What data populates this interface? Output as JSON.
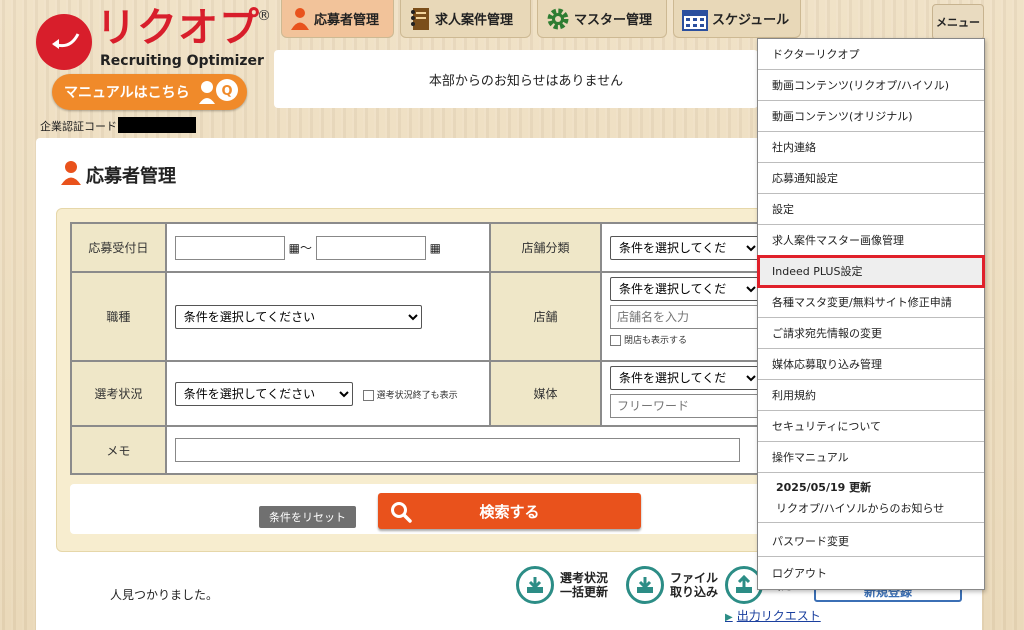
{
  "logo": {
    "kana": "リクオプ",
    "registered": "®",
    "subtitle": "Recruiting Optimizer"
  },
  "manual_button": {
    "label": "マニュアルはこちら",
    "badge": "Q"
  },
  "auth": {
    "label": "企業認証コード:"
  },
  "nav": {
    "tabs": [
      {
        "label": "応募者管理",
        "icon": "person-icon",
        "active": true
      },
      {
        "label": "求人案件管理",
        "icon": "notebook-icon",
        "active": false
      },
      {
        "label": "マスター管理",
        "icon": "gear-icon",
        "active": false
      },
      {
        "label": "スケジュール",
        "icon": "calendar-icon",
        "active": false
      }
    ],
    "menu_label": "メニュー"
  },
  "notice": {
    "text": "本部からのお知らせはありません"
  },
  "page": {
    "title": "応募者管理"
  },
  "form": {
    "date_label": "応募受付日",
    "date_separator": "～",
    "store_category_label": "店舗分類",
    "store_category_value": "条件を選択してくだ",
    "job_type_label": "職種",
    "job_type_value": "条件を選択してください",
    "store_label": "店舗",
    "store_value": "条件を選択してくだ",
    "store_name_placeholder": "店舗名を入力",
    "closed_store_label": "閉店も表示する",
    "status_label": "選考状況",
    "status_value": "条件を選択してください",
    "status_done_label": "選考状況終了も表示",
    "media_label": "媒体",
    "media_value": "条件を選択してくだ",
    "free_word_placeholder": "フリーワード",
    "memo_label": "メモ"
  },
  "buttons": {
    "reset": "条件をリセット",
    "search": "検索する"
  },
  "results": {
    "text": "人見つかりました。"
  },
  "actions": {
    "bulk_update": [
      "選考状況",
      "一括更新"
    ],
    "import": [
      "ファイル",
      "取り込み"
    ],
    "export": "出力",
    "export_request": "出力リクエスト",
    "new_register": "新規登録"
  },
  "menu": {
    "items": [
      "ドクターリクオプ",
      "動画コンテンツ(リクオプ/ハイソル)",
      "動画コンテンツ(オリジナル)",
      "社内連絡",
      "応募通知設定",
      "設定",
      "求人案件マスター画像管理",
      "Indeed PLUS設定",
      "各種マスタ変更/無料サイト修正申請",
      "ご請求宛先情報の変更",
      "媒体応募取り込み管理",
      "利用規約",
      "セキュリティについて",
      "操作マニュアル"
    ],
    "news_date": "2025/05/19 更新",
    "news_text": "リクオプ/ハイソルからのお知らせ",
    "password": "パスワード変更",
    "logout": "ログアウト"
  },
  "colors": {
    "brand_red": "#d81e2b",
    "orange": "#f08a2a",
    "search_orange": "#e9521c",
    "teal": "#2c8d86",
    "highlight": "#e0202a"
  }
}
